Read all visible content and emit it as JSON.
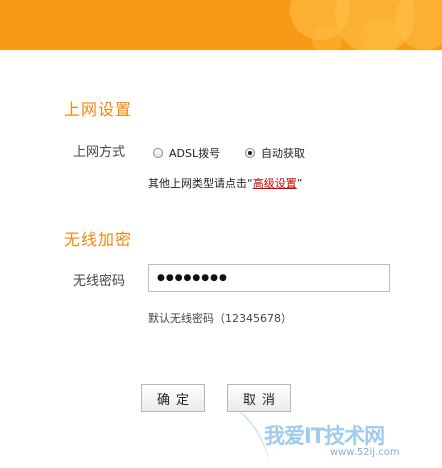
{
  "internet": {
    "title": "上网设置",
    "method_label": "上网方式",
    "options": [
      "ADSL拨号",
      "自动获取"
    ],
    "selected": "自动获取",
    "hint_prefix": "其他上网类型请点击“",
    "hint_link": "高级设置",
    "hint_suffix": "”"
  },
  "wireless": {
    "title": "无线加密",
    "password_label": "无线密码",
    "password_masked": "●●●●●●●●",
    "default_hint": "默认无线密码（12345678）"
  },
  "buttons": {
    "confirm": "确定",
    "cancel": "取消"
  },
  "watermark": {
    "text": "我爱IT技术网",
    "sub": "www.52ij.com"
  },
  "colors": {
    "header": "#f79a16",
    "section_title": "#f2870c",
    "link": "#c80000"
  }
}
